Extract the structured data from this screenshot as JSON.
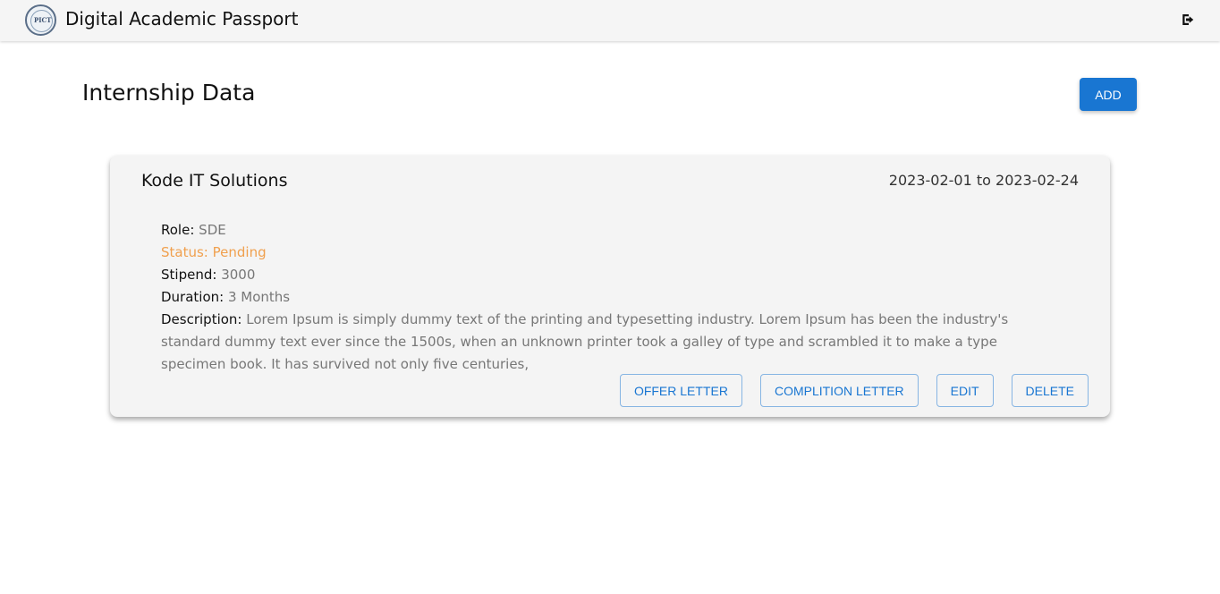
{
  "header": {
    "logo_text": "PICT",
    "title": "Digital Academic Passport",
    "logout_icon": "logout-icon"
  },
  "page": {
    "title": "Internship Data",
    "add_label": "ADD"
  },
  "internship": {
    "company": "Kode IT Solutions",
    "dates": "2023-02-01 to 2023-02-24",
    "role_label": "Role:",
    "role": "SDE",
    "status_label": "Status:",
    "status": "Pending",
    "stipend_label": "Stipend:",
    "stipend": "3000",
    "duration_label": "Duration:",
    "duration": "3 Months",
    "description_label": "Description:",
    "description": "Lorem Ipsum is simply dummy text of the printing and typesetting industry. Lorem Ipsum has been the industry's standard dummy text ever since the 1500s, when an unknown printer took a galley of type and scrambled it to make a type specimen book. It has survived not only five centuries,",
    "actions": {
      "offer_letter": "OFFER LETTER",
      "completion_letter": "COMPLITION LETTER",
      "edit": "EDIT",
      "delete": "DELETE"
    }
  },
  "colors": {
    "primary": "#1976d2",
    "status_pending": "#f0a04e",
    "card_bg": "#f4f4f4",
    "topbar_bg": "#f5f5f5"
  }
}
